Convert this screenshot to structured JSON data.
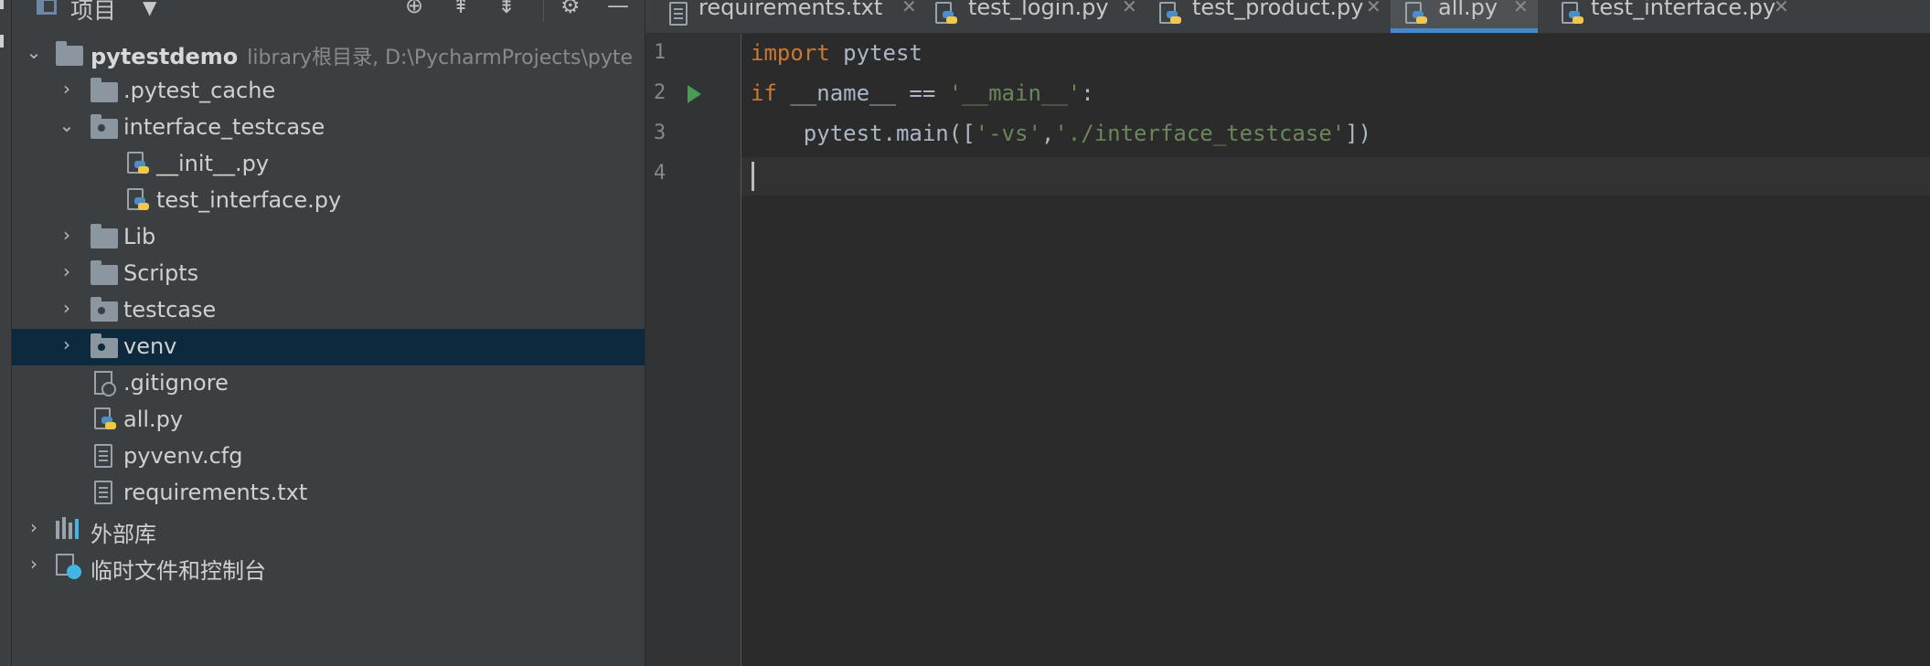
{
  "project_panel": {
    "title": "项目",
    "tree": [
      {
        "label": "pytestdemo",
        "extra": "library根目录,  D:\\PycharmProjects\\pyte",
        "type": "folder",
        "expanded": true,
        "bold": true
      },
      {
        "label": ".pytest_cache",
        "type": "folder",
        "expanded": false
      },
      {
        "label": "interface_testcase",
        "type": "package",
        "expanded": true
      },
      {
        "label": "__init__.py",
        "type": "python"
      },
      {
        "label": "test_interface.py",
        "type": "python"
      },
      {
        "label": "Lib",
        "type": "folder",
        "expanded": false
      },
      {
        "label": "Scripts",
        "type": "folder",
        "expanded": false
      },
      {
        "label": "testcase",
        "type": "package",
        "expanded": false
      },
      {
        "label": "venv",
        "type": "package",
        "expanded": false,
        "selected": true
      },
      {
        "label": ".gitignore",
        "type": "git"
      },
      {
        "label": "all.py",
        "type": "python"
      },
      {
        "label": "pyvenv.cfg",
        "type": "text"
      },
      {
        "label": "requirements.txt",
        "type": "text"
      },
      {
        "label": "外部库",
        "type": "library"
      },
      {
        "label": "临时文件和控制台",
        "type": "scratch"
      }
    ]
  },
  "tabs": [
    {
      "label": "requirements.txt",
      "icon": "text-file-icon",
      "active": false
    },
    {
      "label": "test_login.py",
      "icon": "python-file-icon",
      "active": false
    },
    {
      "label": "test_product.py",
      "icon": "python-file-icon",
      "active": false
    },
    {
      "label": "all.py",
      "icon": "python-file-icon",
      "active": true
    },
    {
      "label": "test_interface.py",
      "icon": "python-file-icon",
      "active": false
    }
  ],
  "editor": {
    "line_numbers": [
      "1",
      "2",
      "3",
      "4"
    ],
    "code": {
      "l1_kw": "import",
      "l1_rest": " pytest",
      "l2_kw": "if",
      "l2_mid": " __name__ == ",
      "l2_str": "'__main__'",
      "l2_end": ":",
      "l3_a": "    pytest.main([",
      "l3_s1": "'-vs'",
      "l3_c": ",",
      "l3_s2": "'./interface_testcase'",
      "l3_e": "])"
    }
  },
  "colors": {
    "keyword": "#cc7832",
    "string": "#6a8759",
    "selection": "#0d293e",
    "accent": "#4a88c7"
  }
}
